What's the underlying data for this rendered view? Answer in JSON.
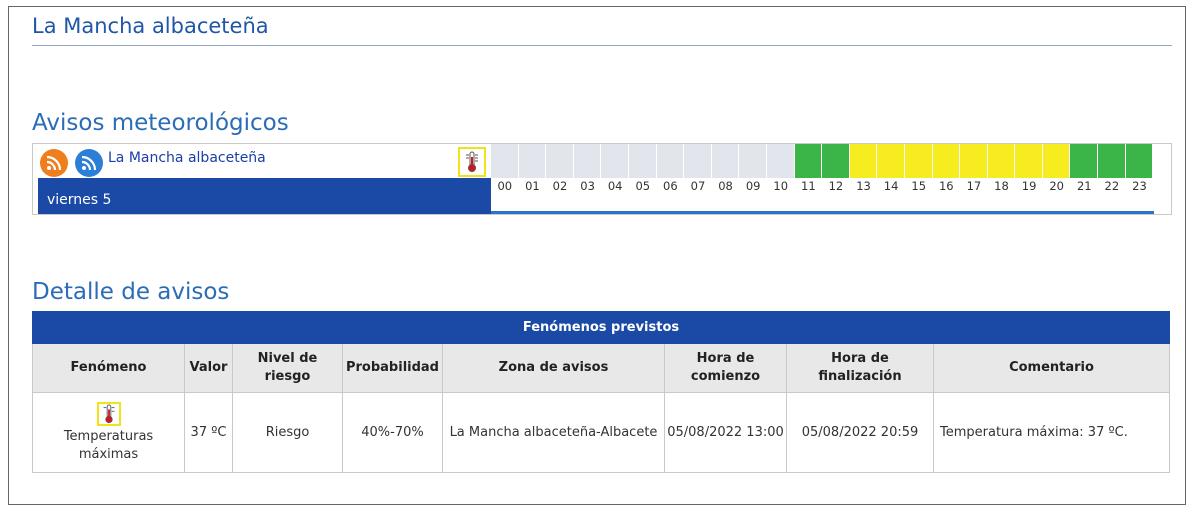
{
  "zone": {
    "title": "La Mancha albaceteña"
  },
  "warnings": {
    "heading": "Avisos meteorológicos",
    "zone_link": "La Mancha albaceteña",
    "day_label": "viernes 5",
    "hours": [
      "00",
      "01",
      "02",
      "03",
      "04",
      "05",
      "06",
      "07",
      "08",
      "09",
      "10",
      "11",
      "12",
      "13",
      "14",
      "15",
      "16",
      "17",
      "18",
      "19",
      "20",
      "21",
      "22",
      "23"
    ],
    "hour_levels": [
      "none",
      "none",
      "none",
      "none",
      "none",
      "none",
      "none",
      "none",
      "none",
      "none",
      "none",
      "green",
      "green",
      "yellow",
      "yellow",
      "yellow",
      "yellow",
      "yellow",
      "yellow",
      "yellow",
      "yellow",
      "green",
      "green",
      "green"
    ],
    "level_colors": {
      "none": "#e2e6ec",
      "green": "#3cb548",
      "yellow": "#f7ec1f"
    },
    "icons": [
      "rss-orange-icon",
      "rss-blue-icon",
      "thermometer-icon"
    ]
  },
  "detail": {
    "heading": "Detalle de avisos",
    "caption": "Fenómenos previstos",
    "columns": [
      "Fenómeno",
      "Valor",
      "Nivel de riesgo",
      "Probabilidad",
      "Zona de avisos",
      "Hora de comienzo",
      "Hora de finalización",
      "Comentario"
    ],
    "row": {
      "phenomenon": "Temperaturas máximas",
      "value": "37 ºC",
      "risk": "Riesgo",
      "probability": "40%-70%",
      "zone": "La Mancha albaceteña-Albacete",
      "start": "05/08/2022 13:00",
      "end": "05/08/2022 20:59",
      "comment": "Temperatura máxima: 37 ºC."
    }
  }
}
